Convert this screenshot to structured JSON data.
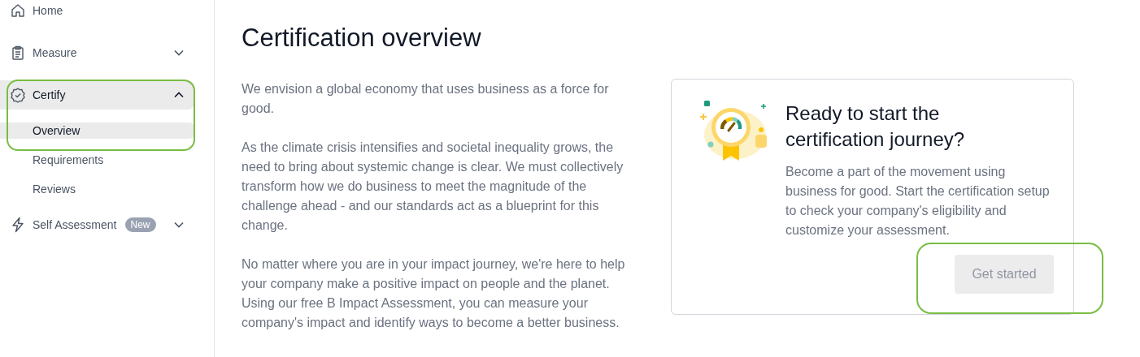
{
  "sidebar": {
    "items": [
      {
        "label": "Home",
        "kind": "home",
        "selected": false
      },
      {
        "label": "Measure",
        "kind": "clipboard",
        "selected": false,
        "expanded": false
      },
      {
        "label": "Certify",
        "kind": "badge",
        "selected": true,
        "expanded": true,
        "children": [
          {
            "label": "Overview",
            "selected": true
          },
          {
            "label": "Requirements",
            "selected": false
          },
          {
            "label": "Reviews",
            "selected": false
          }
        ]
      },
      {
        "label": "Self Assessment",
        "kind": "bolt",
        "selected": false,
        "expanded": false,
        "badge": "New"
      }
    ]
  },
  "main": {
    "title": "Certification overview",
    "paragraphs": [
      "We envision a global economy that uses business as a force for good.",
      "As the climate crisis intensifies and societal inequality grows, the need to bring about systemic change is clear. We must collectively transform how we do business to meet the magnitude of the challenge ahead - and our standards act as a blueprint for this change.",
      "No matter where you are in your impact journey, we're here to help your company make a positive impact on people and the planet. Using our free B Impact Assessment, you can measure your company's impact and identify ways to become a better business."
    ]
  },
  "card": {
    "title": "Ready to start the certification journey?",
    "text": "Become a part of the movement using business for good. Start the certification setup to check your company's eligibility and customize your assessment.",
    "button": {
      "label": "Get started",
      "disabled": true
    }
  }
}
